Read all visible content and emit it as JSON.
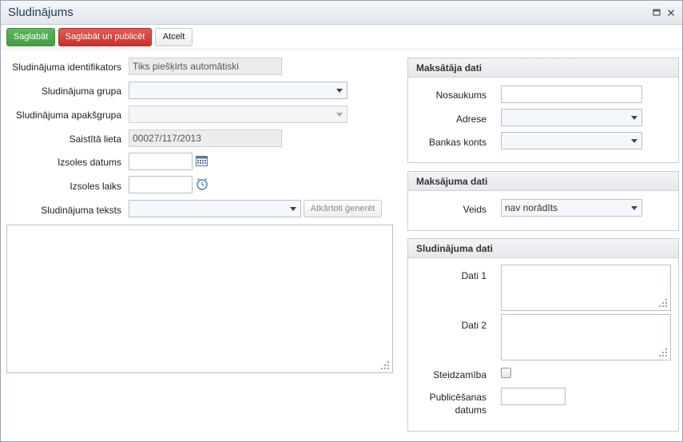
{
  "window": {
    "title": "Sludinājums",
    "maximize_icon": "maximize-icon",
    "close_icon": "close-icon"
  },
  "toolbar": {
    "save_label": "Saglabāt",
    "save_publish_label": "Saglabāt un publicēt",
    "cancel_label": "Atcelt"
  },
  "colors": {
    "save": "#4cae4c",
    "save_publish": "#d9534f",
    "title": "#223a5e"
  },
  "form": {
    "identifier": {
      "label": "Sludinājuma identifikators",
      "value": "Tiks piešķirts automātiski"
    },
    "group": {
      "label": "Sludinājuma grupa",
      "value": ""
    },
    "subgroup": {
      "label": "Sludinājuma apakšgrupa",
      "value": ""
    },
    "related_case": {
      "label": "Saistītā lieta",
      "value": "00027/117/2013"
    },
    "auction_date": {
      "label": "Izsoles datums",
      "value": "",
      "icon": "calendar-icon"
    },
    "auction_time": {
      "label": "Izsoles laiks",
      "value": "",
      "icon": "clock-icon"
    },
    "ad_text": {
      "label": "Sludinājuma teksts",
      "value": "",
      "regenerate_label": "Atkārtoti ģenerēt"
    }
  },
  "payer_panel": {
    "title": "Maksātāja dati",
    "name_label": "Nosaukums",
    "name_value": "",
    "address_label": "Adrese",
    "address_value": "",
    "bank_label": "Bankas konts",
    "bank_value": ""
  },
  "payment_panel": {
    "title": "Maksājuma dati",
    "type_label": "Veids",
    "type_value": "nav norādīts"
  },
  "ad_panel": {
    "title": "Sludinājuma dati",
    "data1_label": "Dati 1",
    "data2_label": "Dati 2",
    "urgency_label": "Steidzamība",
    "urgency_checked": false,
    "publish_date_label_line1": "Publicēšanas",
    "publish_date_label_line2": "datums",
    "publish_date_value": ""
  }
}
